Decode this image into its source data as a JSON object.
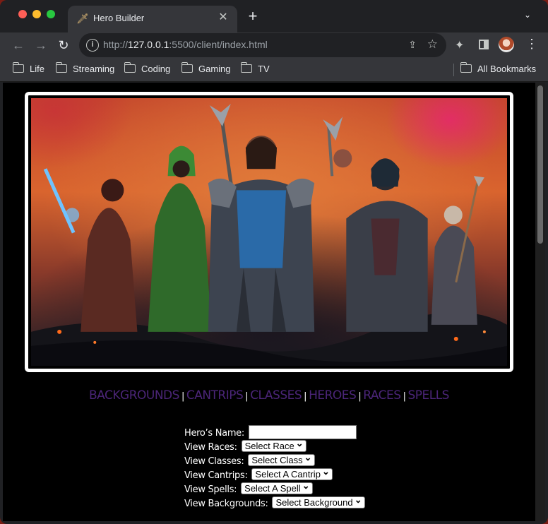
{
  "browser": {
    "tab_title": "Hero Builder",
    "url_protocol": "http://",
    "url_host": "127.0.0.1",
    "url_path": ":5500/client/index.html",
    "bookmarks": [
      "Life",
      "Streaming",
      "Coding",
      "Gaming",
      "TV"
    ],
    "all_bookmarks": "All Bookmarks"
  },
  "nav": {
    "links": [
      "BACKGROUNDS",
      "CANTRIPS",
      "CLASSES",
      "HEROES",
      "RACES",
      "SPELLS"
    ],
    "separator": "|",
    "link_color": "#4b2578"
  },
  "form": {
    "name_label": "Hero’s Name:",
    "name_value": "",
    "races_label": "View Races:",
    "races_select": "Select Race",
    "classes_label": "View Classes:",
    "classes_select": "Select Class",
    "cantrips_label": "View Cantrips:",
    "cantrips_select": "Select A Cantrip",
    "spells_label": "View Spells:",
    "spells_select": "Select A Spell",
    "backgrounds_label": "View Backgrounds:",
    "backgrounds_select": "Select Background"
  },
  "icons": {
    "favicon": "sword-icon",
    "back": "arrow-left-icon",
    "forward": "arrow-right-icon",
    "reload": "reload-icon",
    "info": "info-icon",
    "share": "share-icon",
    "bookmark": "star-icon",
    "extensions": "puzzle-icon",
    "sidepanel": "side-panel-icon",
    "menu": "kebab-menu-icon",
    "folder": "folder-icon"
  }
}
